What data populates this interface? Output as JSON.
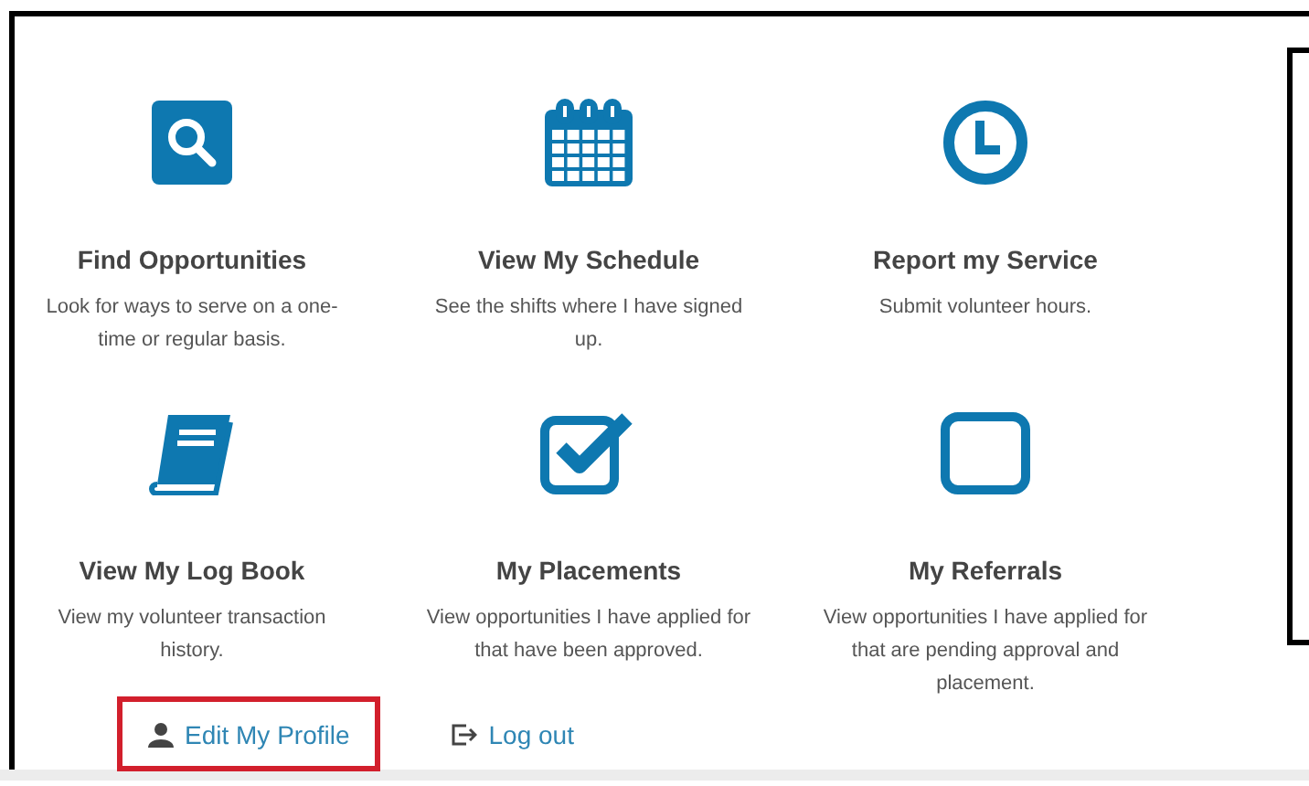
{
  "tiles": [
    {
      "kind": "search",
      "title": "Find Opportunities",
      "description": "Look for ways to serve on a one-time or regular basis."
    },
    {
      "kind": "calendar",
      "title": "View My Schedule",
      "description": "See the shifts where I have signed up."
    },
    {
      "kind": "clock",
      "title": "Report my Service",
      "description": "Submit volunteer hours."
    },
    {
      "kind": "book",
      "title": "View My Log Book",
      "description": "View my volunteer transaction history."
    },
    {
      "kind": "checkbox",
      "title": "My Placements",
      "description": "View opportunities I have applied for that have been approved."
    },
    {
      "kind": "square",
      "title": "My Referrals",
      "description": "View opportunities I have applied for that are pending approval and placement."
    }
  ],
  "links": [
    {
      "kind": "user",
      "label": "Edit My Profile",
      "highlighted": true
    },
    {
      "kind": "logout",
      "label": "Log out",
      "highlighted": false
    }
  ]
}
